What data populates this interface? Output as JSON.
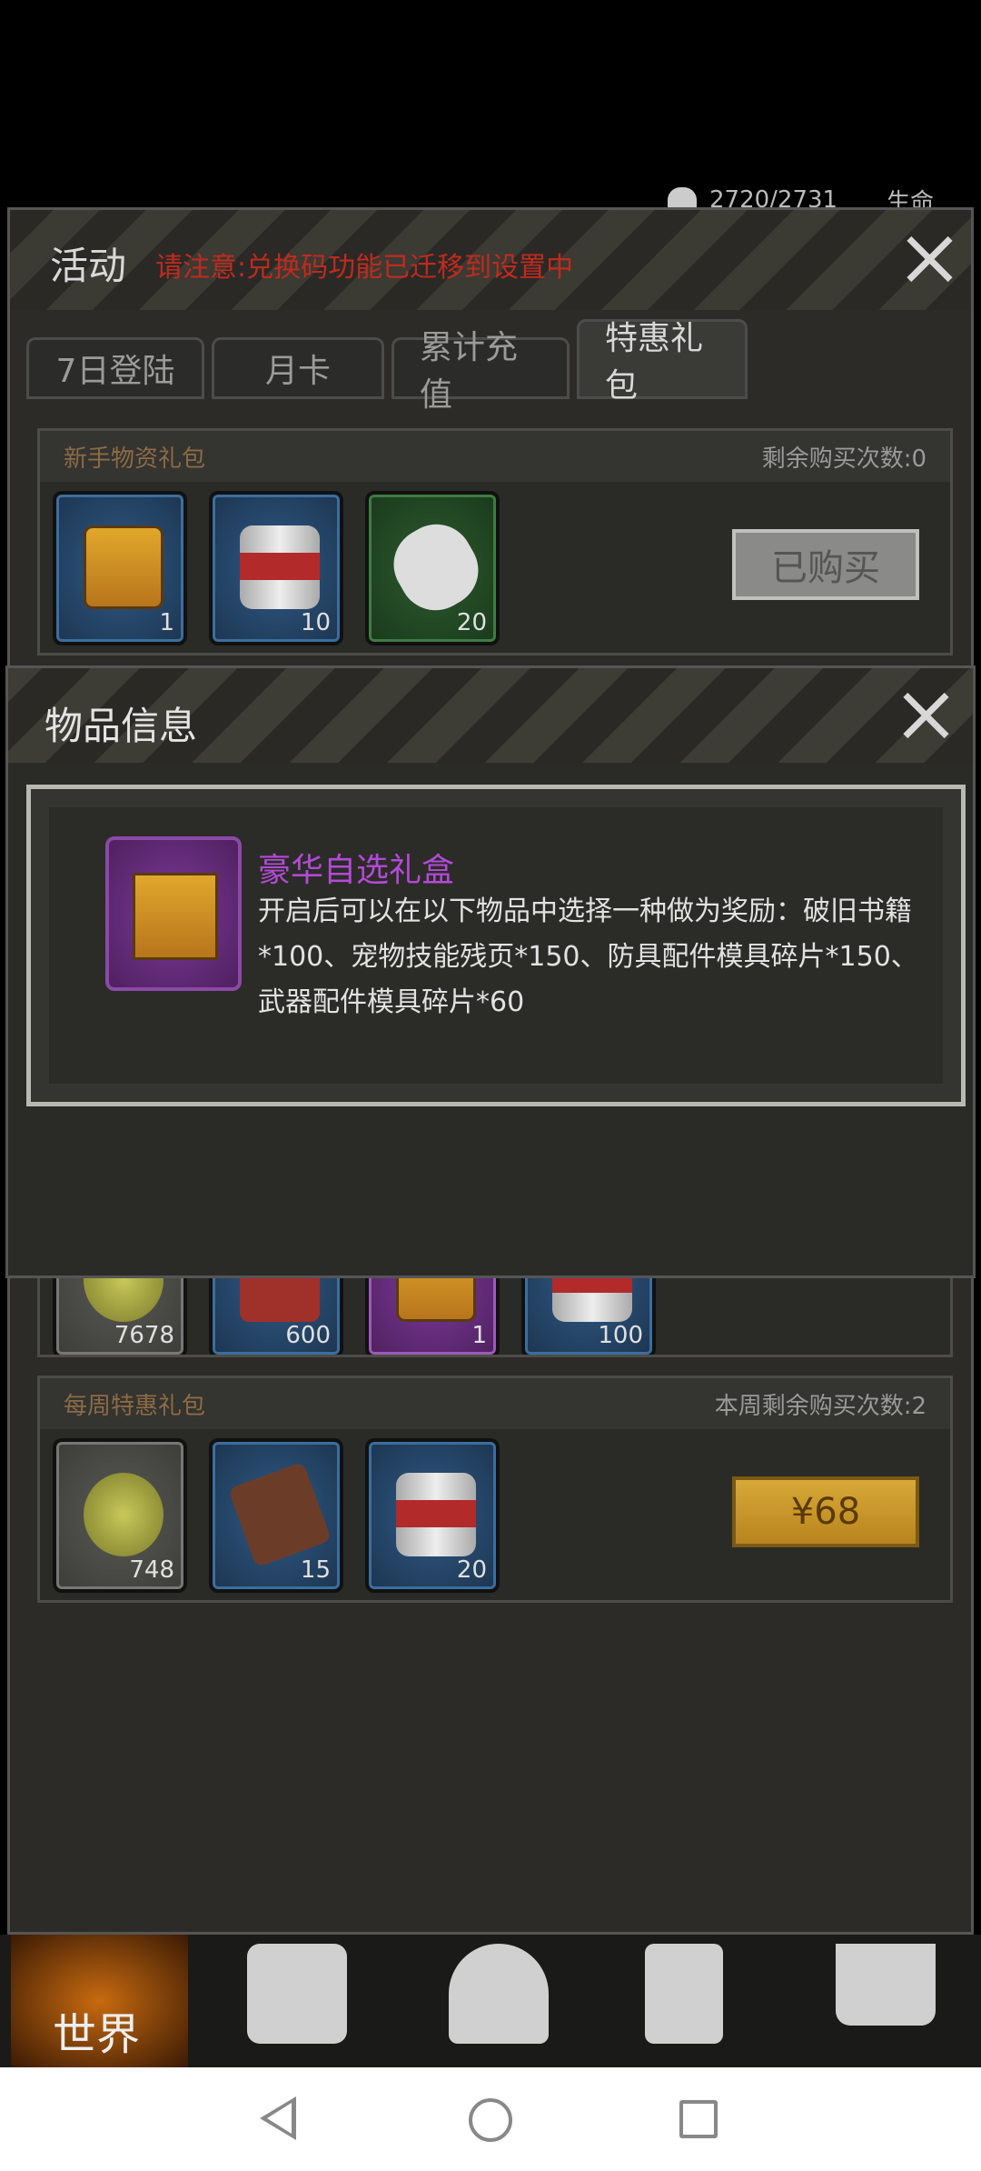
{
  "status": {
    "hp": "2720/2731",
    "hp_label": "生命"
  },
  "activity": {
    "title": "活动",
    "notice": "请注意:兑换码功能已迁移到设置中",
    "tabs": [
      "7日登陆",
      "月卡",
      "累计充值",
      "特惠礼包"
    ]
  },
  "starter_pack": {
    "title": "新手物资礼包",
    "remaining": "剩余购买次数:0",
    "items": [
      {
        "icon": "supply-box",
        "count": "1"
      },
      {
        "icon": "meat-can",
        "count": "10"
      },
      {
        "icon": "medkit",
        "count": "20"
      }
    ],
    "button": "已购买"
  },
  "middle_pack": {
    "items": [
      {
        "icon": "bottle-cap",
        "count": "7678"
      },
      {
        "icon": "jacket",
        "count": "600"
      },
      {
        "icon": "supply-box",
        "count": "1"
      },
      {
        "icon": "meat-can",
        "count": "100"
      }
    ]
  },
  "weekly_pack": {
    "title": "每周特惠礼包",
    "remaining": "本周剩余购买次数:2",
    "items": [
      {
        "icon": "bottle-cap",
        "count": "748"
      },
      {
        "icon": "map",
        "count": "15"
      },
      {
        "icon": "meat-can",
        "count": "20"
      }
    ],
    "button": "¥68"
  },
  "item_info": {
    "title": "物品信息",
    "name": "豪华自选礼盒",
    "description": "开启后可以在以下物品中选择一种做为奖励：破旧书籍*100、宠物技能残页*150、防具配件模具碎片*150、武器配件模具碎片*60"
  },
  "game_nav": {
    "world": "世界"
  }
}
